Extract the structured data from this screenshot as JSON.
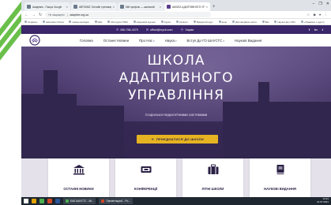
{
  "browser": {
    "tabs": [
      {
        "label": "Академія - Пошук Google",
        "active": false
      },
      {
        "label": "АВТОМАТ-Онлайн тренажер Українська",
        "active": false
      },
      {
        "label": "Мій профіль — шкільний",
        "active": false
      },
      {
        "label": "ШКОЛА АДАПТИВНОГО УПРАВЛІННЯ",
        "active": true
      }
    ],
    "new_tab": "+",
    "window_controls": [
      "–",
      "❐",
      "✕"
    ],
    "nav": {
      "back": "←",
      "forward": "→",
      "reload": "↻"
    },
    "secure_label": "Не защищено",
    "url": "adaptive.org.ua",
    "bookmarks": [
      "Сервисы",
      "Education Portal",
      "Новые вкладки",
      "Wiki",
      "Мої курси ПОМ",
      "Науковий журнал",
      "Курси",
      "Каталог",
      "Відкритий курс",
      "Інше",
      "Дистанційна освіта",
      "Вікі",
      "Науки Науч бібл",
      "«Правові» п-курси"
    ]
  },
  "site": {
    "topbar": {
      "phone": "050-756-4379",
      "email": "office@mycit.com",
      "location": "Харків",
      "social": [
        "f",
        "in",
        "t"
      ]
    },
    "menu": [
      {
        "label": "Головна",
        "has_caret": false
      },
      {
        "label": "Останні Новини",
        "has_caret": false
      },
      {
        "label": "Про Нас",
        "has_caret": true
      },
      {
        "label": "Наука",
        "has_caret": true
      },
      {
        "label": "Вступ До ГО ШАУСТС",
        "has_caret": true
      },
      {
        "label": "Наукові Видання",
        "has_caret": false
      }
    ],
    "hero": {
      "title_lines": [
        "ШКОЛА",
        "АДАПТИВНОГО",
        "УПРАВЛІННЯ"
      ],
      "subtitle": "Соціально-педагогічними системами",
      "cta_label": "ПРИЄДНАТИСЯ ДО ШКОЛИ"
    },
    "cards": [
      {
        "label": "ОСТАННІ НОВИНИ",
        "icon": "building-icon"
      },
      {
        "label": "КОНФЕРЕНЦІЇ",
        "icon": "projector-icon"
      },
      {
        "label": "ЛІТНІ ШКОЛИ",
        "icon": "briefcase-icon"
      },
      {
        "label": "НАУКОВІ ВИДАННЯ",
        "icon": "book-icon"
      }
    ]
  },
  "taskbar": {
    "apps": [
      "ЕАБ ШАУСТС - Мі...",
      "Презентация1 - Po..."
    ],
    "time": "14:31",
    "date": "21.07.2021"
  },
  "colors": {
    "accent_purple": "#3a2668",
    "cta_yellow": "#e6b422",
    "stripe_green": "#6abf4b"
  }
}
